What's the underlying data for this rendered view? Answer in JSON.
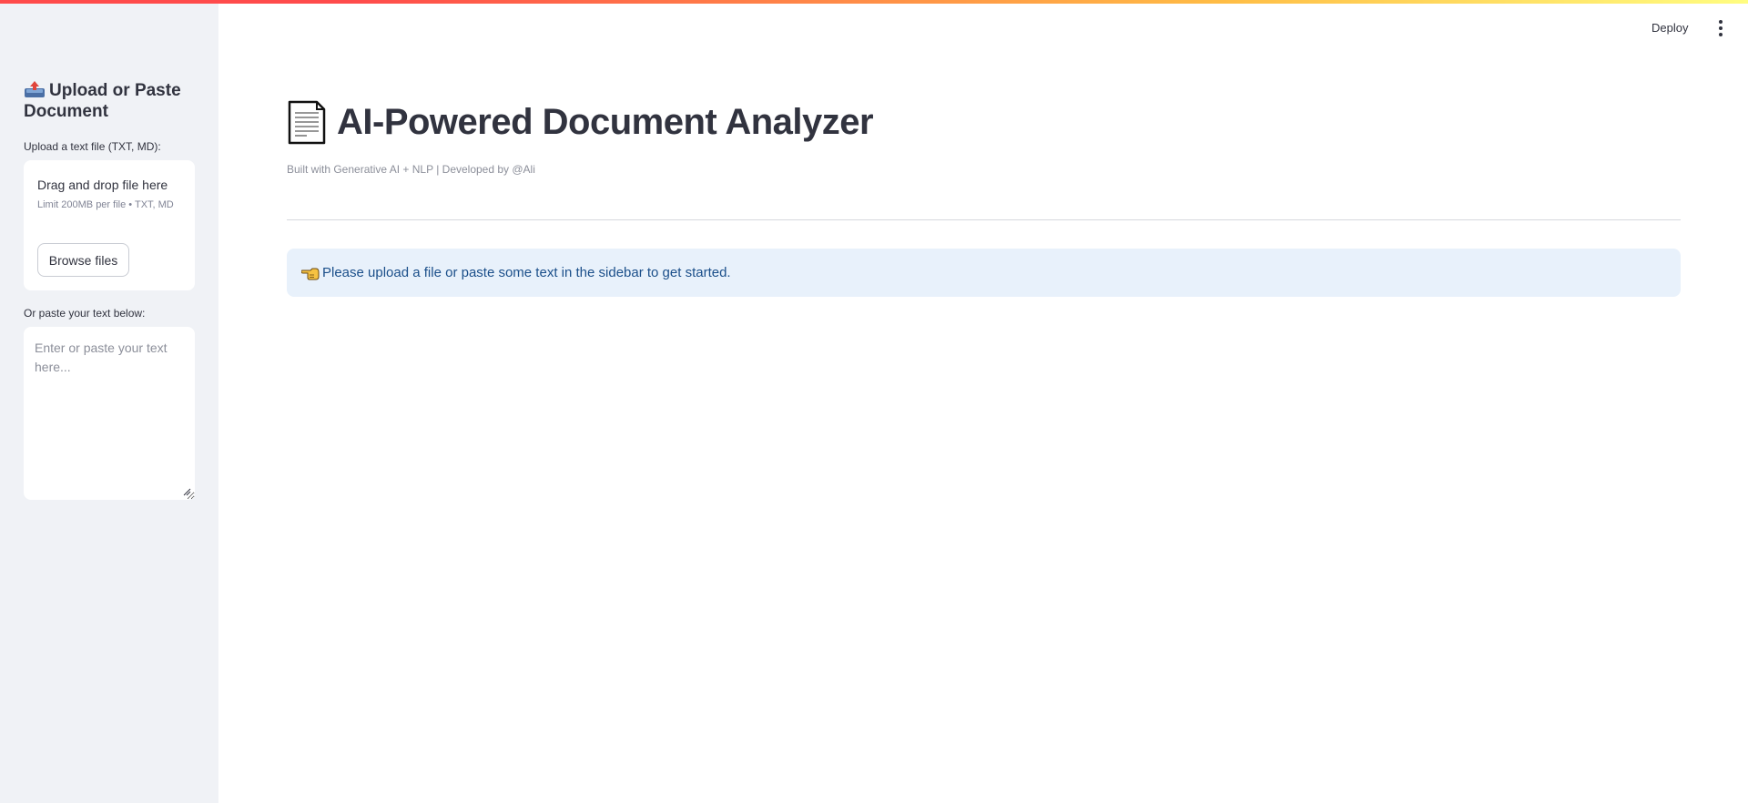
{
  "sidebar": {
    "header": "Upload or Paste Document",
    "header_icon": "outbox-tray-icon",
    "upload_label": "Upload a text file (TXT, MD):",
    "uploader": {
      "title": "Drag and drop file here",
      "limit": "Limit 200MB per file • TXT, MD",
      "browse_label": "Browse files"
    },
    "paste_label": "Or paste your text below:",
    "textarea_placeholder": "Enter or paste your text here..."
  },
  "toolbar": {
    "deploy_label": "Deploy",
    "menu_icon": "vertical-ellipsis-icon"
  },
  "main": {
    "title": "AI-Powered Document Analyzer",
    "title_icon": "page-document-icon",
    "caption": "Built with Generative AI + NLP | Developed by @Ali",
    "info_message": "Please upload a file or paste some text in the sidebar to get started.",
    "info_icon": "pointing-left-hand-icon"
  },
  "colors": {
    "sidebar_bg": "#f0f2f6",
    "info_bg": "#e8f1fb",
    "info_text": "#1b4f8a",
    "text": "#31333f",
    "accent": "#ff4b4b"
  }
}
